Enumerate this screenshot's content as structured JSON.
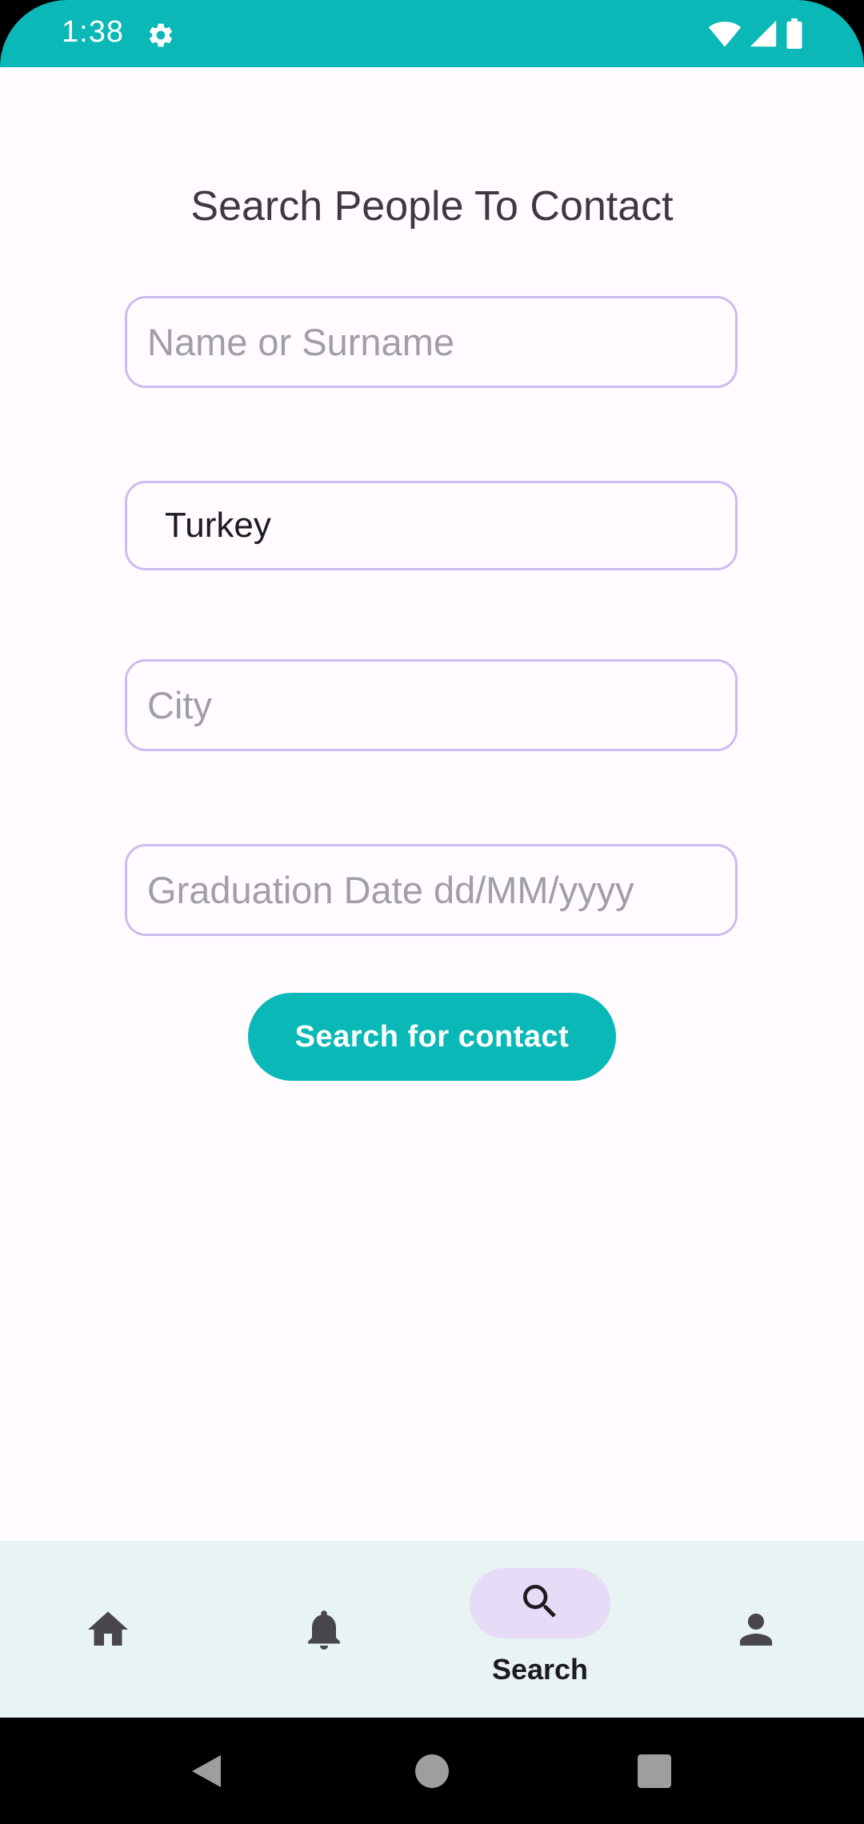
{
  "status_bar": {
    "time": "1:38",
    "background": "#09b8b7"
  },
  "page": {
    "title": "Search People To Contact"
  },
  "form": {
    "name_placeholder": "Name or Surname",
    "country_value": "Turkey",
    "city_placeholder": "City",
    "graduation_placeholder": "Graduation Date dd/MM/yyyy",
    "submit_label": "Search for contact",
    "accent_color": "#09b8b7",
    "field_border_color": "#cbbdf0"
  },
  "bottom_nav": {
    "items": [
      {
        "icon": "home-icon",
        "label": "",
        "active": false
      },
      {
        "icon": "bell-icon",
        "label": "",
        "active": false
      },
      {
        "icon": "search-icon",
        "label": "Search",
        "active": true
      },
      {
        "icon": "person-icon",
        "label": "",
        "active": false
      }
    ]
  },
  "system_nav": {
    "buttons": [
      "back-icon",
      "home-circle-icon",
      "recents-icon"
    ]
  }
}
